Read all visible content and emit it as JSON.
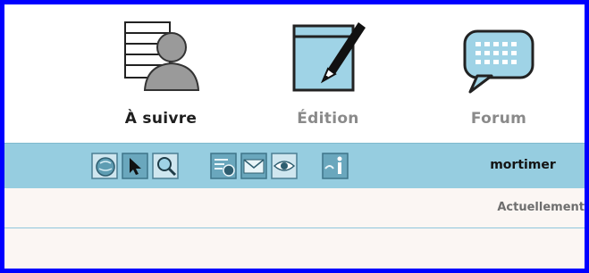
{
  "nav": {
    "items": [
      {
        "label": "À suivre",
        "icon": "user-list-icon",
        "active": true
      },
      {
        "label": "Édition",
        "icon": "edit-pen-icon",
        "active": false
      },
      {
        "label": "Forum",
        "icon": "speech-bubble-icon",
        "active": false
      }
    ]
  },
  "toolbar": {
    "icons": [
      "globe-icon",
      "cursor-arrow-icon",
      "magnifier-icon",
      "list-clock-icon",
      "envelope-icon",
      "eye-icon",
      "help-info-icon"
    ],
    "user_name": "mortimer"
  },
  "info": {
    "currently_label": "Actuellement"
  },
  "colors": {
    "border": "#0000ff",
    "toolbar_bg": "#96cde0",
    "info_bg": "#fbf6f3",
    "icon_blue": "#9fd3e6"
  }
}
